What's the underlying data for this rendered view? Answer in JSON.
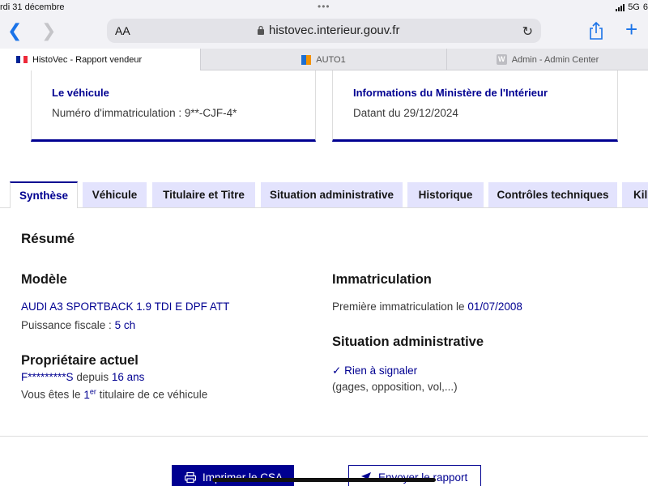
{
  "status_bar": {
    "date": "rdi 31 décembre",
    "dots": "•••",
    "network": "5G",
    "battery": "6"
  },
  "browser": {
    "text_size_label": "AA",
    "url": "histovec.interieur.gouv.fr",
    "tabs": [
      {
        "label": "HistoVec - Rapport vendeur",
        "icon": "french-flag-icon",
        "active": true
      },
      {
        "label": "AUTO1",
        "icon": "auto1-icon",
        "active": false
      },
      {
        "label": "Admin - Admin Center",
        "icon": "w-icon",
        "active": false
      }
    ]
  },
  "cards": {
    "vehicle": {
      "title": "Le véhicule",
      "text": "Numéro d'immatriculation : 9**-CJF-4*"
    },
    "ministry": {
      "title": "Informations du Ministère de l'Intérieur",
      "text": "Datant du 29/12/2024"
    }
  },
  "page_tabs": [
    {
      "label": "Synthèse"
    },
    {
      "label": "Véhicule"
    },
    {
      "label": "Titulaire et Titre"
    },
    {
      "label": "Situation administrative"
    },
    {
      "label": "Historique"
    },
    {
      "label": "Contrôles techniques"
    },
    {
      "label": "Kil"
    }
  ],
  "summary": {
    "title": "Résumé",
    "model_heading": "Modèle",
    "model_value": "AUDI A3 SPORTBACK 1.9 TDI E DPF ATT",
    "fiscal_label": "Puissance fiscale :",
    "fiscal_value": "5 ch",
    "owner_heading": "Propriétaire actuel",
    "owner_name": "F*********S",
    "owner_since_label": "depuis",
    "owner_duration": "16 ans",
    "owner_rank_prefix": "Vous êtes le",
    "owner_rank_num": "1",
    "owner_rank_sup": "er",
    "owner_rank_suffix": "titulaire de ce véhicule",
    "immat_heading": "Immatriculation",
    "first_immat_label": "Première immatriculation le",
    "first_immat_date": "01/07/2008",
    "admin_heading": "Situation administrative",
    "admin_status": "Rien à signaler",
    "admin_details": "(gages, opposition, vol,...)"
  },
  "actions": {
    "print_label": "Imprimer le CSA",
    "send_label": "Envoyer le rapport"
  }
}
